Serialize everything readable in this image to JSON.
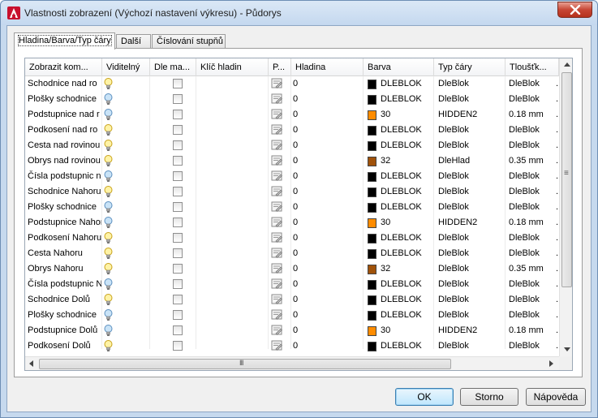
{
  "window": {
    "title": "Vlastnosti zobrazení (Výchozí nastavení výkresu) - Půdorys",
    "app_icon": "autocad-a-icon",
    "close_icon": "close-x-icon"
  },
  "tabs": [
    {
      "label": "Hladina/Barva/Typ čáry",
      "active": true
    },
    {
      "label": "Další",
      "active": false
    },
    {
      "label": "Číslování stupňů",
      "active": false
    }
  ],
  "columns": [
    "Zobrazit kom...",
    "Viditelný",
    "Dle ma...",
    "Klíč hladin",
    "P...",
    "Hladina",
    "Barva",
    "Typ čáry",
    "Tloušťk...",
    ""
  ],
  "rows": [
    {
      "name": "Schodnice nad ro",
      "visible_bulb": "yellow",
      "layer": "0",
      "color_hex": "#000000",
      "color": "DLEBLOK",
      "linetype": "DleBlok",
      "lineweight": "DleBlok",
      "extra": "."
    },
    {
      "name": "Plošky schodnice",
      "visible_bulb": "blue",
      "layer": "0",
      "color_hex": "#000000",
      "color": "DLEBLOK",
      "linetype": "DleBlok",
      "lineweight": "DleBlok",
      "extra": "."
    },
    {
      "name": "Podstupnice nad r",
      "visible_bulb": "blue",
      "layer": "0",
      "color_hex": "#ff8c00",
      "color": "30",
      "linetype": "HIDDEN2",
      "lineweight": "0.18 mm",
      "extra": "."
    },
    {
      "name": "Podkosení nad ro",
      "visible_bulb": "yellow",
      "layer": "0",
      "color_hex": "#000000",
      "color": "DLEBLOK",
      "linetype": "DleBlok",
      "lineweight": "DleBlok",
      "extra": "."
    },
    {
      "name": "Cesta nad rovinou",
      "visible_bulb": "yellow",
      "layer": "0",
      "color_hex": "#000000",
      "color": "DLEBLOK",
      "linetype": "DleBlok",
      "lineweight": "DleBlok",
      "extra": "."
    },
    {
      "name": "Obrys nad rovinou",
      "visible_bulb": "yellow",
      "layer": "0",
      "color_hex": "#a0520a",
      "color": "32",
      "linetype": "DleHlad",
      "lineweight": "0.35 mm",
      "extra": "."
    },
    {
      "name": "Čísla podstupnic n",
      "visible_bulb": "blue",
      "layer": "0",
      "color_hex": "#000000",
      "color": "DLEBLOK",
      "linetype": "DleBlok",
      "lineweight": "DleBlok",
      "extra": "."
    },
    {
      "name": "Schodnice Nahoru",
      "visible_bulb": "yellow",
      "layer": "0",
      "color_hex": "#000000",
      "color": "DLEBLOK",
      "linetype": "DleBlok",
      "lineweight": "DleBlok",
      "extra": "."
    },
    {
      "name": "Plošky schodnice",
      "visible_bulb": "blue",
      "layer": "0",
      "color_hex": "#000000",
      "color": "DLEBLOK",
      "linetype": "DleBlok",
      "lineweight": "DleBlok",
      "extra": "."
    },
    {
      "name": "Podstupnice Nahoru",
      "visible_bulb": "blue",
      "layer": "0",
      "color_hex": "#ff8c00",
      "color": "30",
      "linetype": "HIDDEN2",
      "lineweight": "0.18 mm",
      "extra": "."
    },
    {
      "name": "Podkosení Nahoru",
      "visible_bulb": "yellow",
      "layer": "0",
      "color_hex": "#000000",
      "color": "DLEBLOK",
      "linetype": "DleBlok",
      "lineweight": "DleBlok",
      "extra": "."
    },
    {
      "name": "Cesta Nahoru",
      "visible_bulb": "yellow",
      "layer": "0",
      "color_hex": "#000000",
      "color": "DLEBLOK",
      "linetype": "DleBlok",
      "lineweight": "DleBlok",
      "extra": "."
    },
    {
      "name": "Obrys Nahoru",
      "visible_bulb": "yellow",
      "layer": "0",
      "color_hex": "#a0520a",
      "color": "32",
      "linetype": "DleBlok",
      "lineweight": "0.35 mm",
      "extra": "."
    },
    {
      "name": "Čísla podstupnic N",
      "visible_bulb": "blue",
      "layer": "0",
      "color_hex": "#000000",
      "color": "DLEBLOK",
      "linetype": "DleBlok",
      "lineweight": "DleBlok",
      "extra": "."
    },
    {
      "name": "Schodnice Dolů",
      "visible_bulb": "yellow",
      "layer": "0",
      "color_hex": "#000000",
      "color": "DLEBLOK",
      "linetype": "DleBlok",
      "lineweight": "DleBlok",
      "extra": "."
    },
    {
      "name": "Plošky schodnice",
      "visible_bulb": "blue",
      "layer": "0",
      "color_hex": "#000000",
      "color": "DLEBLOK",
      "linetype": "DleBlok",
      "lineweight": "DleBlok",
      "extra": "."
    },
    {
      "name": "Podstupnice Dolů",
      "visible_bulb": "blue",
      "layer": "0",
      "color_hex": "#ff8c00",
      "color": "30",
      "linetype": "HIDDEN2",
      "lineweight": "0.18 mm",
      "extra": "."
    },
    {
      "name": "Podkosení Dolů",
      "visible_bulb": "yellow",
      "layer": "0",
      "color_hex": "#000000",
      "color": "DLEBLOK",
      "linetype": "DleBlok",
      "lineweight": "DleBlok",
      "extra": "."
    }
  ],
  "scrollbar": {
    "vthumb_grip": "≡",
    "hthumb_grip": "III"
  },
  "buttons": {
    "ok": "OK",
    "cancel": "Storno",
    "help": "Nápověda"
  }
}
